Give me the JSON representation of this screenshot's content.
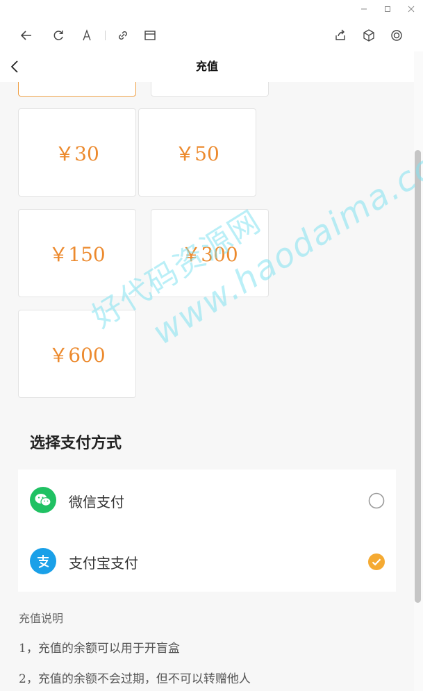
{
  "header": {
    "title": "充值"
  },
  "amounts": [
    {
      "label": "",
      "selected": true
    },
    {
      "label": "",
      "selected": false
    },
    {
      "label": "￥30",
      "selected": false
    },
    {
      "label": "￥50",
      "selected": false
    },
    {
      "label": "￥150",
      "selected": false
    },
    {
      "label": "￥300",
      "selected": false
    },
    {
      "label": "￥600",
      "selected": false
    }
  ],
  "payment": {
    "heading": "选择支付方式",
    "methods": [
      {
        "label": "微信支付",
        "icon": "wechat-icon",
        "color": "#20c163",
        "selected": false
      },
      {
        "label": "支付宝支付",
        "icon": "alipay-icon",
        "color": "#1aa0e8",
        "selected": true
      }
    ]
  },
  "notes": {
    "title": "充值说明",
    "items": [
      "1，充值的余额可以用于开盲盒",
      "2，充值的余额不会过期，但不可以转赠他人"
    ]
  },
  "watermark": {
    "line1": "好代码资源网",
    "line2": "www.haodaima.cc"
  },
  "colors": {
    "accent": "#ec8a2e",
    "check": "#f5aa32"
  }
}
